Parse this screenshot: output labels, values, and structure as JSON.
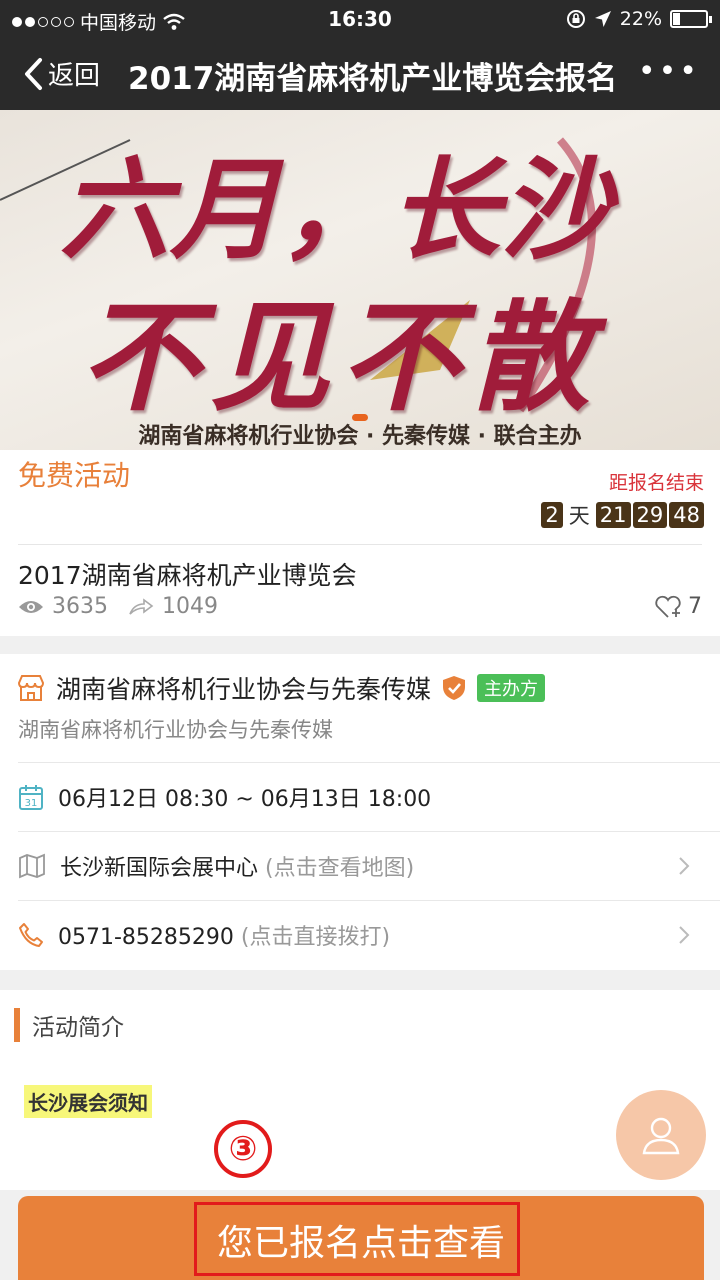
{
  "status_bar": {
    "carrier": "中国移动",
    "time": "16:30",
    "battery": "22%",
    "battery_level": 0.22
  },
  "nav": {
    "back_label": "返回",
    "title": "2017湖南省麻将机产业博览会报名"
  },
  "banner": {
    "headline_1": "六月，长沙",
    "headline_2": "不见不散",
    "subtitle": "湖南省麻将机行业协会 · 先秦传媒 · 联合主办"
  },
  "event": {
    "type_label": "免费活动",
    "deadline_label": "距报名结束",
    "countdown": {
      "days": "2",
      "days_unit": "天",
      "hours": "21",
      "minutes": "29",
      "seconds": "48"
    },
    "title": "2017湖南省麻将机产业博览会",
    "views": "3635",
    "shares": "1049",
    "likes": "7"
  },
  "organizer": {
    "name": "湖南省麻将机行业协会与先秦传媒",
    "badge": "主办方",
    "subtitle": "湖南省麻将机行业协会与先秦传媒"
  },
  "details": {
    "datetime": "06月12日 08:30 ~ 06月13日 18:00",
    "calendar_day": "31",
    "venue": "长沙新国际会展中心",
    "venue_hint": "(点击查看地图)",
    "phone": "0571-85285290",
    "phone_hint": "(点击直接拨打)"
  },
  "intro": {
    "heading": "活动简介",
    "notice": "长沙展会须知"
  },
  "annotation": {
    "step": "③"
  },
  "bottom_button": {
    "label": "您已报名点击查看"
  },
  "colors": {
    "accent": "#e8813a",
    "nav_bg": "#2a2a2a",
    "deadline": "#d9343b",
    "badge_green": "#4bbf58",
    "highlight": "#e21b1b"
  }
}
